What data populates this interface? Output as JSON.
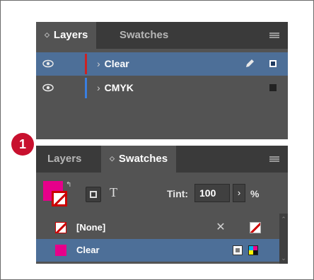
{
  "step_badge": "1",
  "layers_panel": {
    "tabs": [
      {
        "label": "Layers",
        "active": true
      },
      {
        "label": "Swatches",
        "active": false
      }
    ],
    "rows": [
      {
        "name": "Clear",
        "selected": true,
        "visible": true,
        "color": "#cc2222"
      },
      {
        "name": "CMYK",
        "selected": false,
        "visible": true,
        "color": "#3a7fe0"
      }
    ]
  },
  "swatches_panel": {
    "tabs": [
      {
        "label": "Layers",
        "active": false
      },
      {
        "label": "Swatches",
        "active": true
      }
    ],
    "fill_color": "#e6008a",
    "text_icon": "T",
    "tint_label": "Tint:",
    "tint_value": "100",
    "tint_percent": "%",
    "swatches": [
      {
        "name": "[None]",
        "selected": false
      },
      {
        "name": "Clear",
        "selected": true,
        "color": "#e6008a"
      }
    ]
  },
  "colors": {
    "panel_bg": "#535353",
    "tab_bar_bg": "#3a3a3a",
    "selection": "#4d6f98",
    "badge": "#c8102e"
  }
}
